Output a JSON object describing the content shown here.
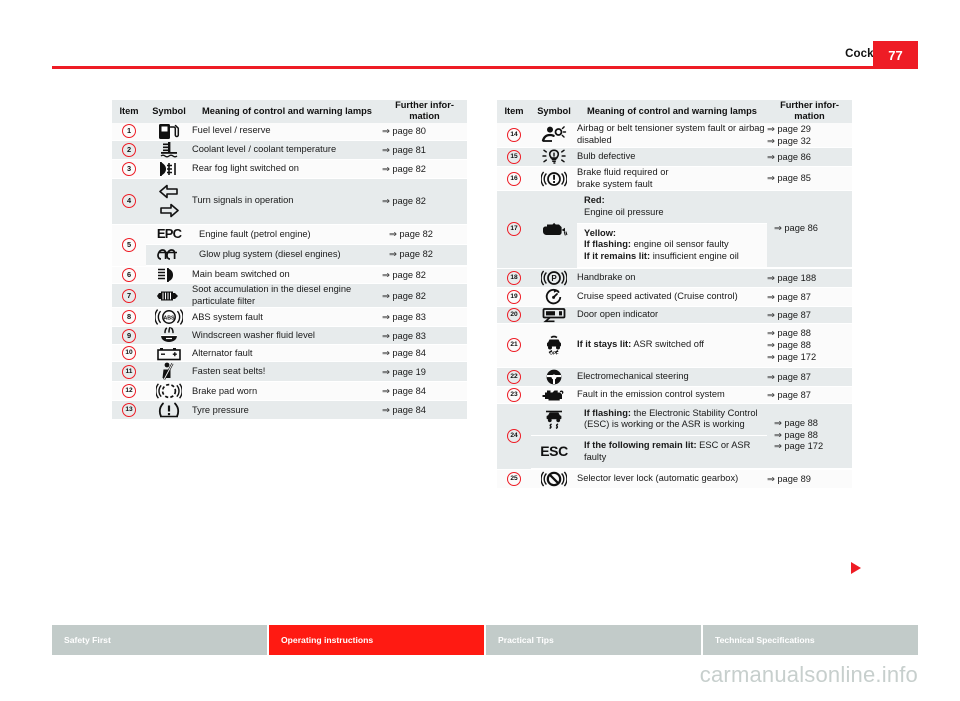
{
  "header": {
    "title": "Cockpit",
    "page_number": "77"
  },
  "columns": {
    "item": "Item",
    "symbol": "Symbol",
    "meaning": "Meaning of control and warning lamps",
    "further_info": "Further infor-\nmation",
    "further_info_line1": "Further infor-",
    "further_info_line2": "mation"
  },
  "left_table": {
    "rows": [
      {
        "item": "1",
        "icon": "fuel-pump-icon",
        "meaning": "Fuel level / reserve",
        "info": [
          "⇒ page 80"
        ]
      },
      {
        "item": "2",
        "icon": "coolant-temperature-icon",
        "meaning": "Coolant level / coolant temperature",
        "info": [
          "⇒ page 81"
        ]
      },
      {
        "item": "3",
        "icon": "rear-fog-light-icon",
        "meaning": "Rear fog light switched on",
        "info": [
          "⇒ page 82"
        ]
      },
      {
        "item": "4",
        "icon": "turn-signals-icon",
        "meaning": "Turn signals in operation",
        "info": [
          "⇒ page 82"
        ]
      },
      {
        "item": "5",
        "icon": "epc-glowplug-split",
        "sub": [
          {
            "icon": "epc-icon",
            "meaning": "Engine fault (petrol engine)",
            "info": "⇒ page 82"
          },
          {
            "icon": "glow-plug-icon",
            "meaning": "Glow plug system (diesel engines)",
            "info": "⇒ page 82"
          }
        ]
      },
      {
        "item": "6",
        "icon": "main-beam-icon",
        "meaning": "Main beam switched on",
        "info": [
          "⇒ page 82"
        ]
      },
      {
        "item": "7",
        "icon": "diesel-particulate-filter-icon",
        "meaning": "Soot accumulation in the diesel engine particulate filter",
        "info": [
          "⇒ page 82"
        ]
      },
      {
        "item": "8",
        "icon": "abs-icon",
        "meaning": "ABS system fault",
        "info": [
          "⇒ page 83"
        ]
      },
      {
        "item": "9",
        "icon": "windscreen-washer-icon",
        "meaning": "Windscreen washer fluid level",
        "info": [
          "⇒ page 83"
        ]
      },
      {
        "item": "10",
        "icon": "alternator-battery-icon",
        "meaning": "Alternator fault",
        "info": [
          "⇒ page 84"
        ]
      },
      {
        "item": "11",
        "icon": "seat-belt-icon",
        "meaning": "Fasten seat belts!",
        "info": [
          "⇒ page 19"
        ]
      },
      {
        "item": "12",
        "icon": "brake-pad-icon",
        "meaning": "Brake pad worn",
        "info": [
          "⇒ page 84"
        ]
      },
      {
        "item": "13",
        "icon": "tyre-pressure-icon",
        "meaning": "Tyre pressure",
        "info": [
          "⇒ page 84"
        ]
      }
    ]
  },
  "right_table": {
    "rows": [
      {
        "item": "14",
        "icon": "airbag-icon",
        "meaning": "Airbag or belt tensioner system fault or airbag disabled",
        "info": [
          "⇒ page 29",
          "⇒ page 32"
        ]
      },
      {
        "item": "15",
        "icon": "bulb-defective-icon",
        "meaning": "Bulb defective",
        "info": [
          "⇒ page 86"
        ]
      },
      {
        "item": "16",
        "icon": "brake-fluid-icon",
        "meaning": "Brake fluid required or\nbrake system fault",
        "meaning_lines": [
          "Brake fluid required or",
          "brake system fault"
        ],
        "info": [
          "⇒ page 85"
        ]
      },
      {
        "item": "17",
        "icon": "engine-oil-icon",
        "split": true,
        "sub": [
          {
            "lines": [
              {
                "bold": "Red:"
              },
              {
                "text": "Engine oil pressure"
              }
            ]
          },
          {
            "lines": [
              {
                "bold": "Yellow:"
              },
              {
                "bold": "If flashing:",
                "text": " engine oil sensor faulty"
              },
              {
                "bold": "If it remains lit:",
                "text": " insufficient engine oil"
              }
            ]
          }
        ],
        "info": [
          "⇒ page 86"
        ]
      },
      {
        "item": "18",
        "icon": "handbrake-icon",
        "meaning": "Handbrake on",
        "info": [
          "⇒ page 188"
        ]
      },
      {
        "item": "19",
        "icon": "cruise-control-icon",
        "meaning": "Cruise speed activated (Cruise control)",
        "info": [
          "⇒ page 87"
        ]
      },
      {
        "item": "20",
        "icon": "door-open-icon",
        "meaning": "Door open indicator",
        "info": [
          "⇒ page 87"
        ]
      },
      {
        "item": "21",
        "icon": "asr-off-icon",
        "meaning_bold": "If it stays lit:",
        "meaning_rest": " ASR switched off",
        "info": [
          "⇒ page 88",
          "⇒ page 88",
          "⇒ page 172"
        ]
      },
      {
        "item": "22",
        "icon": "steering-wheel-icon",
        "meaning": "Electromechanical steering",
        "info": [
          "⇒ page 87"
        ]
      },
      {
        "item": "23",
        "icon": "engine-emission-icon",
        "meaning": "Fault in the emission control system",
        "info": [
          "⇒ page 87"
        ]
      },
      {
        "item": "24",
        "icon": "esc-split",
        "split": true,
        "sub": [
          {
            "icon": "esc-skid-icon",
            "lines": [
              {
                "bold": "If flashing:",
                "text": " the Electronic Stability Control (ESC) is working or the ASR is working"
              }
            ]
          },
          {
            "icon": "esc-text-icon",
            "lines": [
              {
                "bold": "If the following remain lit:",
                "text": " ESC or ASR faulty"
              }
            ]
          }
        ],
        "info": [
          "⇒ page 88",
          "⇒ page 88",
          "⇒ page 172"
        ]
      },
      {
        "item": "25",
        "icon": "selector-lever-lock-icon",
        "meaning": "Selector lever lock (automatic gearbox)",
        "info": [
          "⇒ page 89"
        ]
      }
    ]
  },
  "footer": {
    "tabs": [
      {
        "label": "Safety First",
        "active": false
      },
      {
        "label": "Operating instructions",
        "active": true
      },
      {
        "label": "Practical Tips",
        "active": false
      },
      {
        "label": "Technical Specifications",
        "active": false
      }
    ]
  },
  "watermark": {
    "text": "carmanualsonline.info"
  },
  "colors": {
    "accent_red": "#ee1c25",
    "footer_active_red": "#ff1a12",
    "band_light": "#fbfbfb",
    "band_grey": "#e7ebec",
    "footer_grey": "#c2cbc9"
  }
}
